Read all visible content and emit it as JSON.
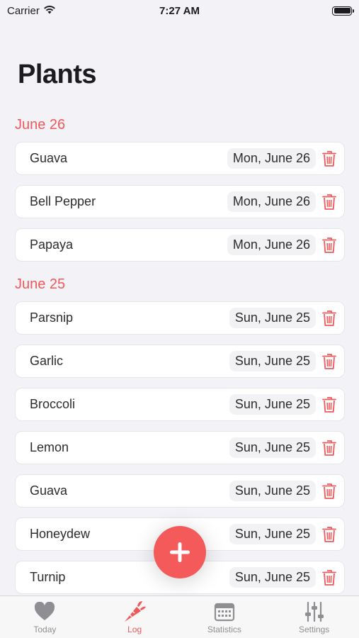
{
  "status_bar": {
    "carrier": "Carrier",
    "time": "7:27 AM"
  },
  "page": {
    "title": "Plants"
  },
  "colors": {
    "accent": "#f0585a",
    "background": "#f2f2f7"
  },
  "sections": [
    {
      "header": "June 26",
      "rows": [
        {
          "name": "Guava",
          "date": "Mon, June 26"
        },
        {
          "name": "Bell Pepper",
          "date": "Mon, June 26"
        },
        {
          "name": "Papaya",
          "date": "Mon, June 26"
        }
      ]
    },
    {
      "header": "June 25",
      "rows": [
        {
          "name": "Parsnip",
          "date": "Sun, June 25"
        },
        {
          "name": "Garlic",
          "date": "Sun, June 25"
        },
        {
          "name": "Broccoli",
          "date": "Sun, June 25"
        },
        {
          "name": "Lemon",
          "date": "Sun, June 25"
        },
        {
          "name": "Guava",
          "date": "Sun, June 25"
        },
        {
          "name": "Honeydew",
          "date": "Sun, June 25"
        },
        {
          "name": "Turnip",
          "date": "Sun, June 25"
        }
      ]
    }
  ],
  "tabs": [
    {
      "label": "Today",
      "icon": "heart-icon"
    },
    {
      "label": "Log",
      "icon": "carrot-icon",
      "active": true
    },
    {
      "label": "Statistics",
      "icon": "calendar-icon"
    },
    {
      "label": "Settings",
      "icon": "sliders-icon"
    }
  ]
}
